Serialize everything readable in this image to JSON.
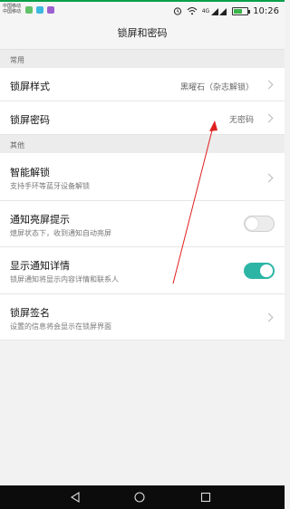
{
  "status_bar": {
    "carrier_1": "中国移动",
    "carrier_2": "中国移动",
    "network": "4G",
    "time": "10:26",
    "battery_percent": 60
  },
  "header": {
    "title": "锁屏和密码"
  },
  "sections": {
    "common": "常用",
    "other": "其他"
  },
  "rows": {
    "lock_style": {
      "title": "锁屏样式",
      "value": "黑曜石（杂志解锁）"
    },
    "lock_password": {
      "title": "锁屏密码",
      "value": "无密码"
    },
    "smart_unlock": {
      "title": "智能解锁",
      "subtitle": "支持手环等蓝牙设备解锁"
    },
    "notify_wake": {
      "title": "通知亮屏提示",
      "subtitle": "熄屏状态下，收到通知自动亮屏",
      "enabled": false
    },
    "show_details": {
      "title": "显示通知详情",
      "subtitle": "锁屏通知将显示内容详情和联系人",
      "enabled": true
    },
    "lock_signature": {
      "title": "锁屏签名",
      "subtitle": "设置的信息将会显示在锁屏界面"
    }
  },
  "colors": {
    "accent": "#2cb5a5",
    "annotation": "#e01f1f",
    "status_accent": "#0aa04a"
  },
  "icons": {
    "back": "triangle-back-icon",
    "home": "circle-home-icon",
    "recents": "square-recents-icon"
  }
}
